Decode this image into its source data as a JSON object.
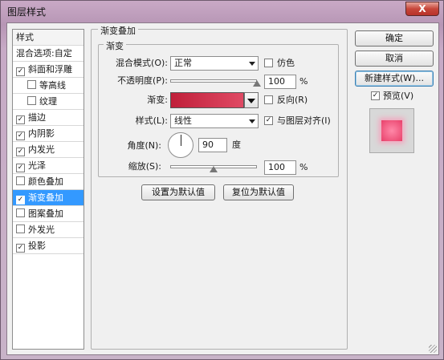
{
  "window": {
    "title": "图层样式",
    "close_glyph": "X"
  },
  "style_list": {
    "header": "样式",
    "items": [
      {
        "label": "混合选项:自定",
        "checkbox": false,
        "checked": false,
        "indent": false,
        "selected": false
      },
      {
        "label": "斜面和浮雕",
        "checkbox": true,
        "checked": true,
        "indent": false,
        "selected": false
      },
      {
        "label": "等高线",
        "checkbox": true,
        "checked": false,
        "indent": true,
        "selected": false
      },
      {
        "label": "纹理",
        "checkbox": true,
        "checked": false,
        "indent": true,
        "selected": false
      },
      {
        "label": "描边",
        "checkbox": true,
        "checked": true,
        "indent": false,
        "selected": false
      },
      {
        "label": "内阴影",
        "checkbox": true,
        "checked": true,
        "indent": false,
        "selected": false
      },
      {
        "label": "内发光",
        "checkbox": true,
        "checked": true,
        "indent": false,
        "selected": false
      },
      {
        "label": "光泽",
        "checkbox": true,
        "checked": true,
        "indent": false,
        "selected": false
      },
      {
        "label": "颜色叠加",
        "checkbox": true,
        "checked": false,
        "indent": false,
        "selected": false
      },
      {
        "label": "渐变叠加",
        "checkbox": true,
        "checked": true,
        "indent": false,
        "selected": true
      },
      {
        "label": "图案叠加",
        "checkbox": true,
        "checked": false,
        "indent": false,
        "selected": false
      },
      {
        "label": "外发光",
        "checkbox": true,
        "checked": false,
        "indent": false,
        "selected": false
      },
      {
        "label": "投影",
        "checkbox": true,
        "checked": true,
        "indent": false,
        "selected": false
      }
    ]
  },
  "panel": {
    "title": "渐变叠加",
    "group_title": "渐变",
    "blend_mode_label": "混合模式(O):",
    "blend_mode_value": "正常",
    "dither_label": "仿色",
    "dither_checked": false,
    "opacity_label": "不透明度(P):",
    "opacity_value": "100",
    "opacity_unit": "%",
    "opacity_level": 1.0,
    "gradient_label": "渐变:",
    "reverse_label": "反向(R)",
    "reverse_checked": false,
    "style_label": "样式(L):",
    "style_value": "线性",
    "align_label": "与图层对齐(I)",
    "align_checked": true,
    "angle_label": "角度(N):",
    "angle_value": "90",
    "angle_unit": "度",
    "scale_label": "缩放(S):",
    "scale_value": "100",
    "scale_unit": "%",
    "scale_level": 0.5,
    "set_default_label": "设置为默认值",
    "reset_default_label": "复位为默认值"
  },
  "actions": {
    "ok_label": "确定",
    "cancel_label": "取消",
    "new_style_label": "新建样式(W)...",
    "preview_label": "预览(V)",
    "preview_checked": true
  },
  "colors": {
    "gradient_start": "#c0203a",
    "gradient_end": "#e04a64",
    "selection": "#3399ff"
  },
  "icons": {
    "check": "✓"
  }
}
